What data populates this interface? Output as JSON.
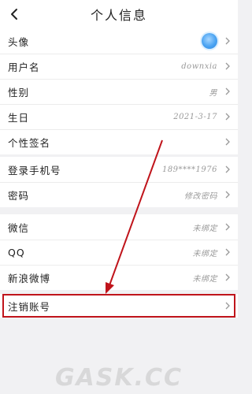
{
  "header": {
    "title": "个人信息"
  },
  "group1": [
    {
      "label": "头像",
      "value": ""
    },
    {
      "label": "用户名",
      "value": "downxia"
    },
    {
      "label": "性别",
      "value": "男"
    },
    {
      "label": "生日",
      "value": "2021-3-17"
    },
    {
      "label": "个性签名",
      "value": ""
    }
  ],
  "group2": [
    {
      "label": "登录手机号",
      "value": "189****1976"
    },
    {
      "label": "密码",
      "value": "修改密码"
    }
  ],
  "group3": [
    {
      "label": "微信",
      "value": "未绑定"
    },
    {
      "label": "QQ",
      "value": "未绑定"
    },
    {
      "label": "新浪微博",
      "value": "未绑定"
    }
  ],
  "group4": [
    {
      "label": "注销账号",
      "value": ""
    }
  ],
  "watermark": "GASK.CC",
  "colors": {
    "highlight": "#c0141b",
    "arrow": "#c0141b",
    "avatar": "#4aa3f2"
  }
}
